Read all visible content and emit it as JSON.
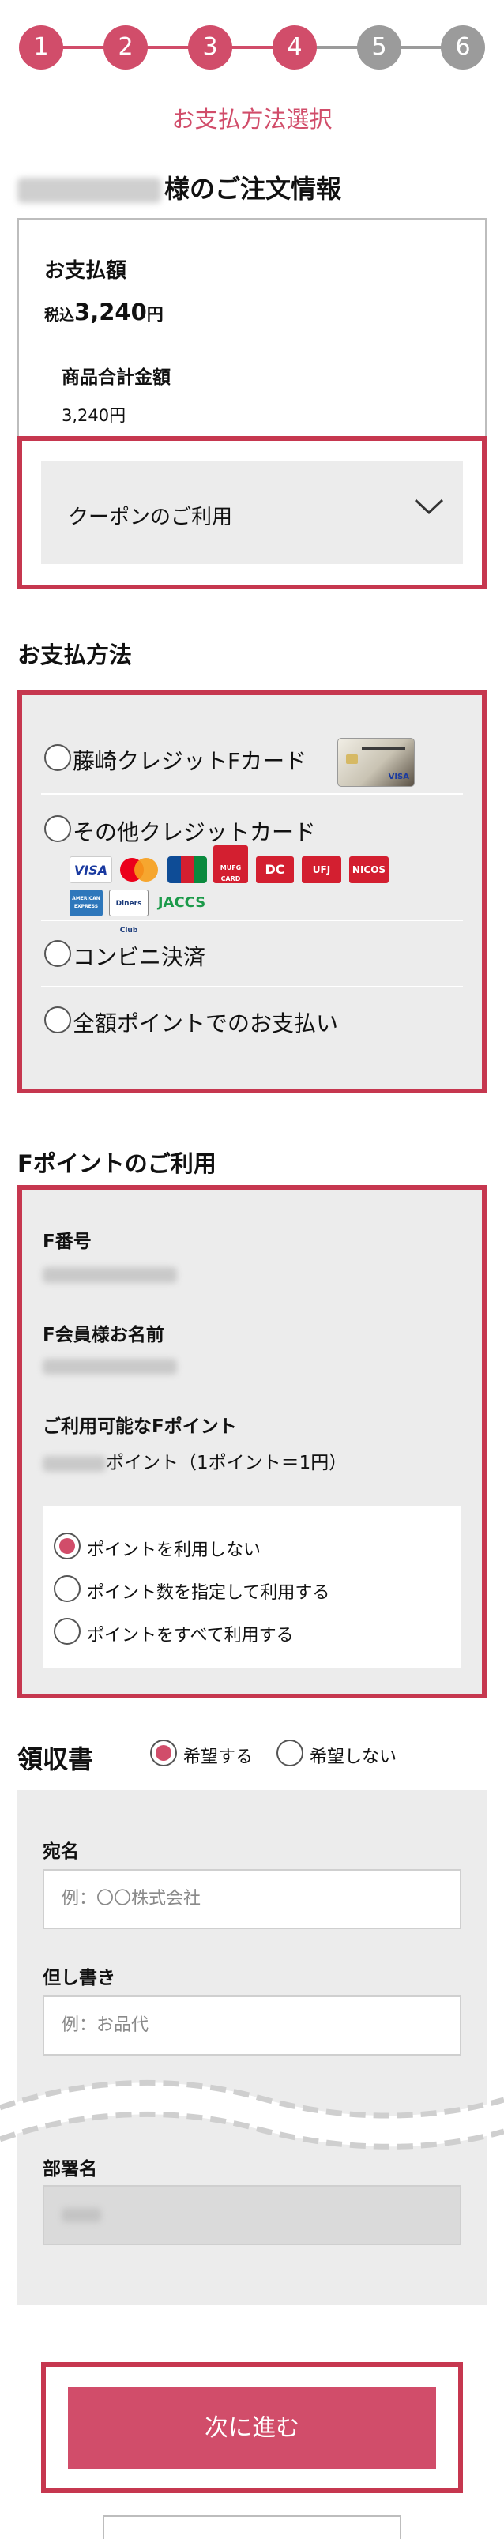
{
  "steps": [
    "1",
    "2",
    "3",
    "4",
    "5",
    "6"
  ],
  "current_step": 4,
  "colors": {
    "accent": "#d14d6a",
    "frame": "#c6374f",
    "inactive": "#9b9b9b",
    "panel": "#ececec"
  },
  "page_heading": "お支払方法選択",
  "order": {
    "title_suffix": "様のご注文情報",
    "payment_label": "お支払額",
    "tax_prefix": "税込",
    "total": "3,240",
    "yen": "円",
    "subtotal_label": "商品合計金額",
    "subtotal_value": "3,240円",
    "coupon_label": "クーポンのご利用",
    "coupon_icon": "chevron-down-icon"
  },
  "payment": {
    "title": "お支払方法",
    "options": [
      {
        "label": "藤崎クレジットFカード",
        "selected": false
      },
      {
        "label": "その他クレジットカード",
        "selected": false
      },
      {
        "label": "コンビニ決済",
        "selected": false
      },
      {
        "label": "全額ポイントでのお支払い",
        "selected": false
      }
    ],
    "card_brands": [
      "VISA",
      "MUFG CARD",
      "DC",
      "UFJ",
      "NICOS",
      "AMERICAN EXPRESS",
      "Diners Club",
      "JACCS"
    ],
    "card_visa_mark": "VISA"
  },
  "fpoint": {
    "title": "Fポイントのご利用",
    "number_label": "F番号",
    "name_label": "F会員様お名前",
    "available_label": "ご利用可能なFポイント",
    "points_suffix": "ポイント（1ポイント＝1円）",
    "options": [
      {
        "label": "ポイントを利用しない",
        "selected": true
      },
      {
        "label": "ポイント数を指定して利用する",
        "selected": false
      },
      {
        "label": "ポイントをすべて利用する",
        "selected": false
      }
    ]
  },
  "receipt": {
    "title": "領収書",
    "options": [
      {
        "label": "希望する",
        "selected": true
      },
      {
        "label": "希望しない",
        "selected": false
      }
    ],
    "addressee_label": "宛名",
    "addressee_placeholder": "例：〇〇株式会社",
    "note_label": "但し書き",
    "note_placeholder": "例：お品代",
    "dept_label": "部署名"
  },
  "next_button": "次に進む"
}
